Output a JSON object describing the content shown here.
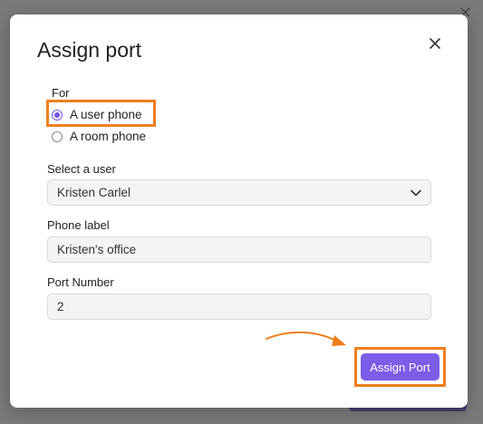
{
  "dialog": {
    "title": "Assign port",
    "for_label": "For",
    "options": [
      {
        "label": "A user phone",
        "selected": true
      },
      {
        "label": "A room phone",
        "selected": false
      }
    ],
    "select_user": {
      "label": "Select a user",
      "value": "Kristen Carlel"
    },
    "phone_label": {
      "label": "Phone label",
      "value": "Kristen's office"
    },
    "port_number": {
      "label": "Port Number",
      "value": "2"
    },
    "submit_label": "Assign Port"
  },
  "colors": {
    "accent": "#7c5ce8",
    "highlight": "#f07f1e"
  },
  "icons": [
    "close-icon",
    "chevron-down-icon",
    "arrow-annotation-icon"
  ]
}
